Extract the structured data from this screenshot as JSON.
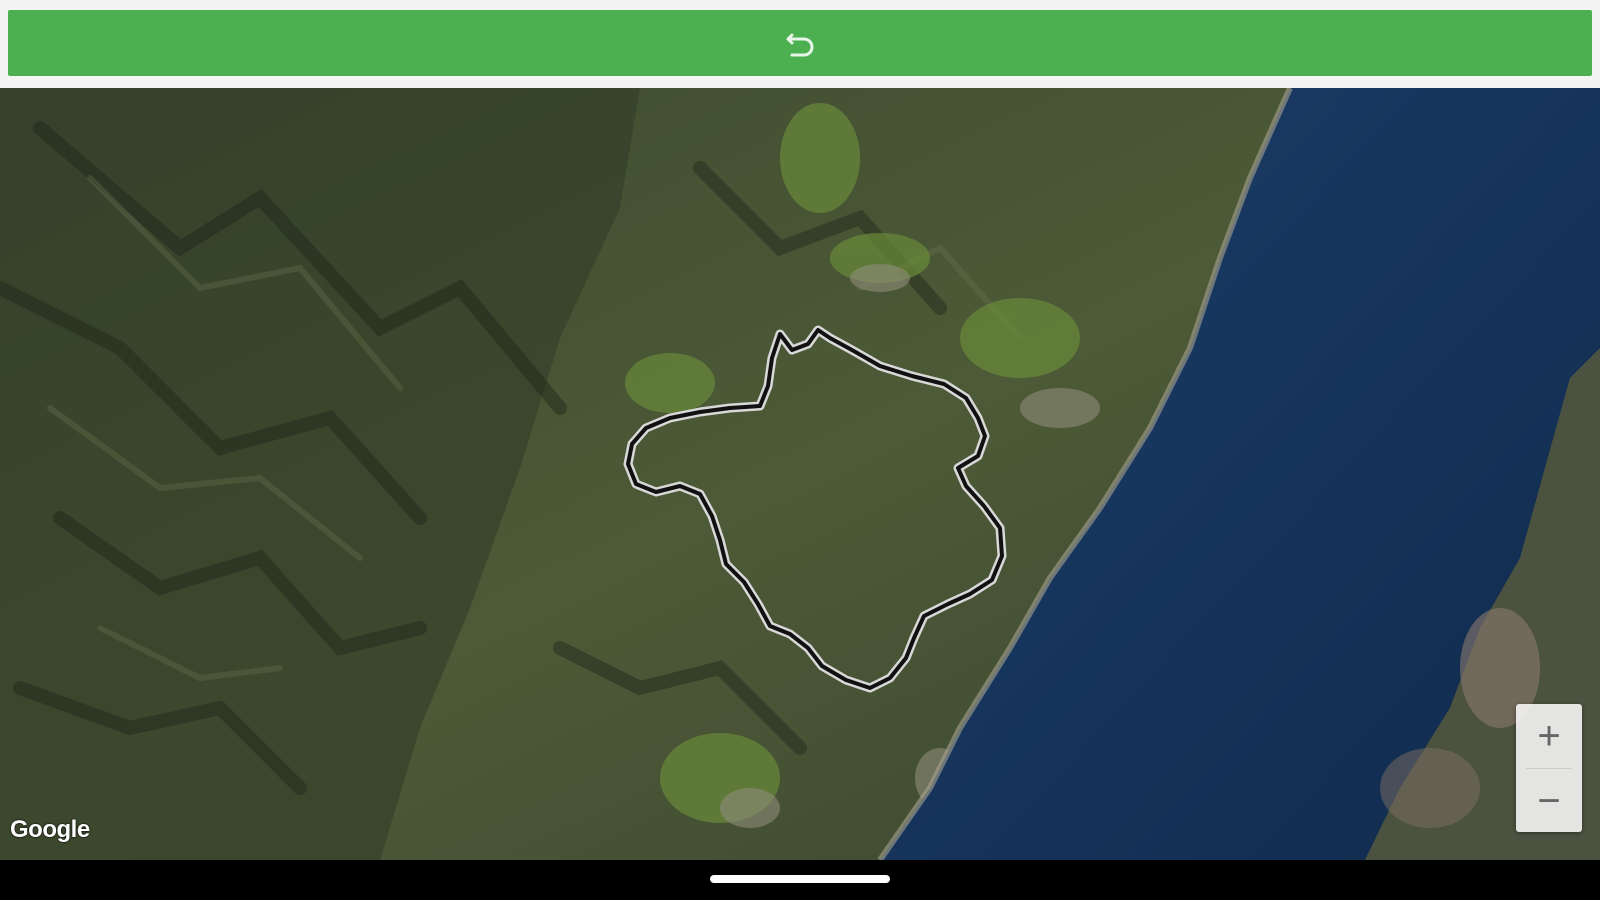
{
  "toolbar": {
    "back_icon": "undo-arrow-icon",
    "color": "#4caf50"
  },
  "map": {
    "type": "satellite",
    "attribution": "Google",
    "zoom_in_label": "+",
    "zoom_out_label": "−",
    "route_color": "#111111",
    "route_outline": "#d8d8d8",
    "water_color": "#16345c"
  },
  "navbar": {
    "indicator": "home-indicator"
  }
}
